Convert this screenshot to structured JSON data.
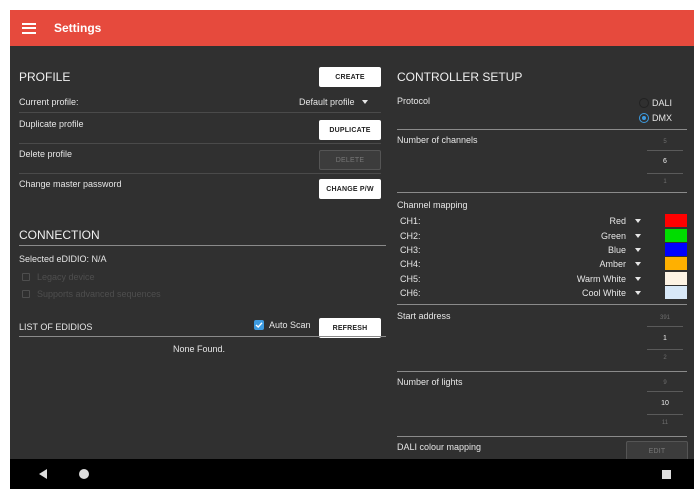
{
  "appbar": {
    "title": "Settings"
  },
  "profile": {
    "title": "PROFILE",
    "create_label": "CREATE",
    "current_label": "Current profile:",
    "current_value": "Default profile",
    "duplicate_label": "Duplicate profile",
    "duplicate_button": "DUPLICATE",
    "delete_label": "Delete profile",
    "delete_button": "DELETE",
    "password_label": "Change master password",
    "password_button": "CHANGE P/W"
  },
  "connection": {
    "title": "CONNECTION",
    "selected": "Selected eDIDIO: N/A",
    "legacy": "Legacy device",
    "advanced": "Supports advanced sequences"
  },
  "list": {
    "title": "LIST OF EDIDIOS",
    "auto_scan": "Auto Scan",
    "refresh": "REFRESH",
    "empty": "None Found."
  },
  "controller": {
    "title": "CONTROLLER SETUP",
    "protocol_label": "Protocol",
    "protocol_options": [
      "DALI",
      "DMX"
    ],
    "protocol_selected": "DMX",
    "channels_label": "Number of channels",
    "channels_picker": {
      "prev": "5",
      "value": "6",
      "next": "1"
    },
    "mapping_label": "Channel mapping",
    "channels": [
      {
        "ch": "CH1:",
        "value": "Red",
        "color": "#ff0000"
      },
      {
        "ch": "CH2:",
        "value": "Green",
        "color": "#00dd00"
      },
      {
        "ch": "CH3:",
        "value": "Blue",
        "color": "#0000ff"
      },
      {
        "ch": "CH4:",
        "value": "Amber",
        "color": "#ffb000"
      },
      {
        "ch": "CH5:",
        "value": "Warm White",
        "color": "#fdf3e4"
      },
      {
        "ch": "CH6:",
        "value": "Cool White",
        "color": "#d8e8f8"
      }
    ],
    "start_label": "Start address",
    "start_picker": {
      "prev": "391",
      "value": "1",
      "next": "2"
    },
    "lights_label": "Number of lights",
    "lights_picker": {
      "prev": "9",
      "value": "10",
      "next": "11"
    },
    "dali_label": "DALI colour mapping",
    "edit_label": "EDIT"
  },
  "colors": {
    "appbar": "#e64a3d",
    "background": "#303030",
    "accent": "#3d9be0"
  }
}
